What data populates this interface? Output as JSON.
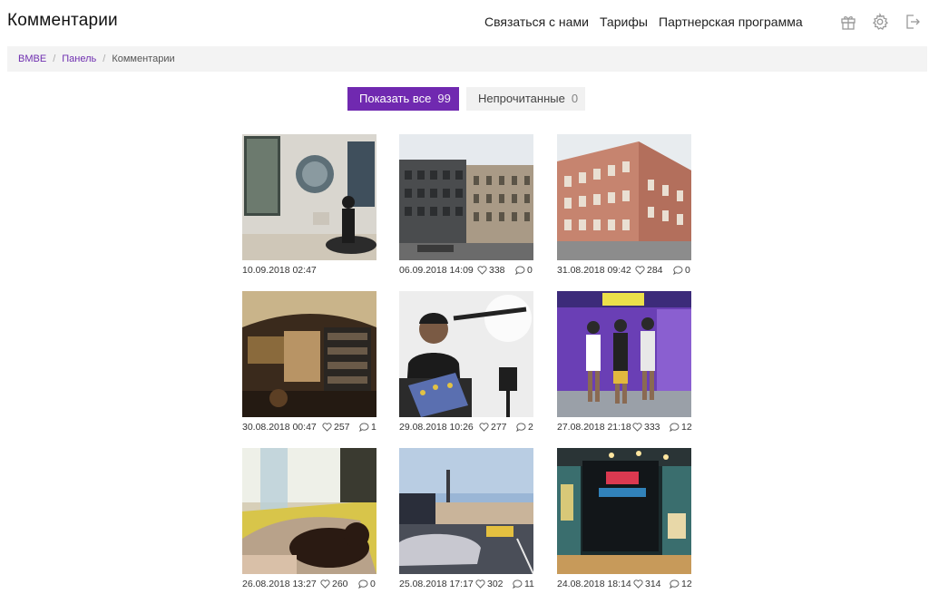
{
  "header": {
    "title": "Комментарии",
    "nav": [
      "Связаться с нами",
      "Тарифы",
      "Партнерская программа"
    ],
    "icons": [
      "gift-icon",
      "gear-icon",
      "logout-icon"
    ]
  },
  "breadcrumb": [
    "BMBE",
    "Панель",
    "Комментарии"
  ],
  "filters": {
    "all_label": "Показать все",
    "all_count": "99",
    "unread_label": "Непрочитанные",
    "unread_count": "0"
  },
  "posts": [
    {
      "date": "10.09.2018 02:47",
      "likes": "",
      "comments": ""
    },
    {
      "date": "06.09.2018 14:09",
      "likes": "338",
      "comments": "0"
    },
    {
      "date": "31.08.2018 09:42",
      "likes": "284",
      "comments": "0"
    },
    {
      "date": "30.08.2018 00:47",
      "likes": "257",
      "comments": "1"
    },
    {
      "date": "29.08.2018 10:26",
      "likes": "277",
      "comments": "2"
    },
    {
      "date": "27.08.2018 21:18",
      "likes": "333",
      "comments": "12"
    },
    {
      "date": "26.08.2018 13:27",
      "likes": "260",
      "comments": "0"
    },
    {
      "date": "25.08.2018 17:17",
      "likes": "302",
      "comments": "11"
    },
    {
      "date": "24.08.2018 18:14",
      "likes": "314",
      "comments": "12"
    }
  ],
  "colors": {
    "accent": "#7029b0",
    "breadcrumb_bg": "#f3f3f3"
  }
}
